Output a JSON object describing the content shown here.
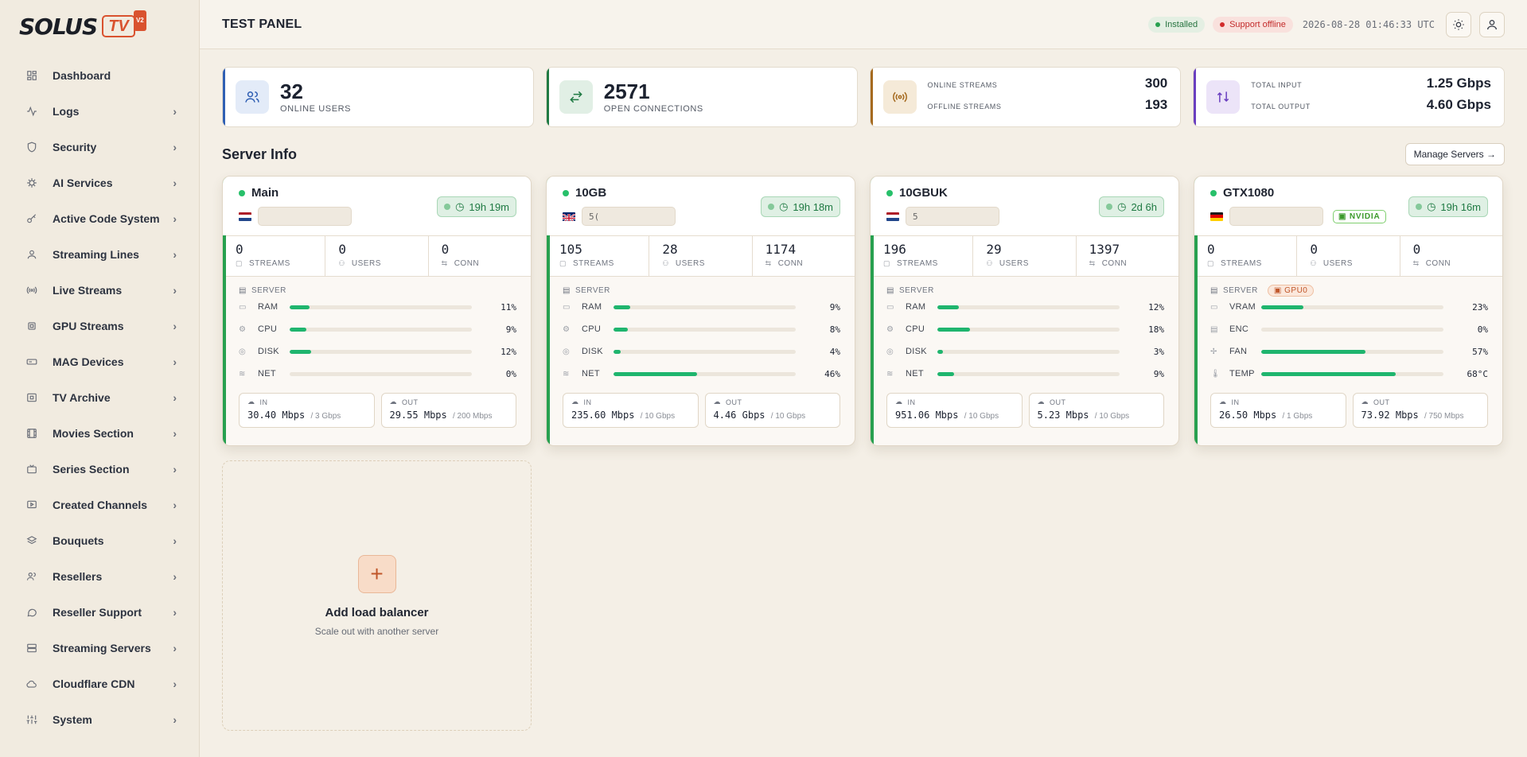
{
  "logo": {
    "word": "SOLUS",
    "tv": "TV",
    "badge": "V2"
  },
  "sidebar": {
    "items": [
      {
        "label": "Dashboard",
        "icon": "grid-icon",
        "chevron": false
      },
      {
        "label": "Logs",
        "icon": "activity-icon",
        "chevron": true
      },
      {
        "label": "Security",
        "icon": "shield-icon",
        "chevron": true
      },
      {
        "label": "AI Services",
        "icon": "cpu-icon",
        "chevron": true
      },
      {
        "label": "Active Code System",
        "icon": "key-icon",
        "chevron": true
      },
      {
        "label": "Streaming Lines",
        "icon": "user-icon",
        "chevron": true
      },
      {
        "label": "Live Streams",
        "icon": "broadcast-icon",
        "chevron": true
      },
      {
        "label": "GPU Streams",
        "icon": "chip-icon",
        "chevron": true
      },
      {
        "label": "MAG Devices",
        "icon": "device-icon",
        "chevron": true
      },
      {
        "label": "TV Archive",
        "icon": "archive-icon",
        "chevron": true
      },
      {
        "label": "Movies Section",
        "icon": "film-icon",
        "chevron": true
      },
      {
        "label": "Series Section",
        "icon": "tv-icon",
        "chevron": true
      },
      {
        "label": "Created Channels",
        "icon": "play-icon",
        "chevron": true
      },
      {
        "label": "Bouquets",
        "icon": "layers-icon",
        "chevron": true
      },
      {
        "label": "Resellers",
        "icon": "users-icon",
        "chevron": true
      },
      {
        "label": "Reseller Support",
        "icon": "chat-icon",
        "chevron": true
      },
      {
        "label": "Streaming Servers",
        "icon": "server-icon",
        "chevron": true
      },
      {
        "label": "Cloudflare CDN",
        "icon": "cloud-icon",
        "chevron": true
      },
      {
        "label": "System",
        "icon": "sliders-icon",
        "chevron": true
      }
    ]
  },
  "header": {
    "title": "TEST PANEL",
    "installed": "Installed",
    "support": "Support offline",
    "clock": "2026-08-28 01:46:33 UTC"
  },
  "stats": {
    "users": {
      "value": "32",
      "label": "ONLINE USERS"
    },
    "connections": {
      "value": "2571",
      "label": "OPEN CONNECTIONS"
    },
    "streams": {
      "online_label": "ONLINE STREAMS",
      "online_value": "300",
      "offline_label": "OFFLINE STREAMS",
      "offline_value": "193"
    },
    "traffic": {
      "input_label": "TOTAL INPUT",
      "input_value": "1.25 Gbps",
      "output_label": "TOTAL OUTPUT",
      "output_value": "4.60 Gbps"
    }
  },
  "section": {
    "title": "Server Info",
    "manage_label": "Manage Servers →"
  },
  "servers": [
    {
      "name": "Main",
      "flag": "nl",
      "ip": "",
      "uptime": "19h 19m",
      "gpu": false,
      "metrics": [
        {
          "v": "0",
          "l": "STREAMS"
        },
        {
          "v": "0",
          "l": "USERS"
        },
        {
          "v": "0",
          "l": "CONN"
        }
      ],
      "section_label": "SERVER",
      "bars": [
        {
          "label": "RAM",
          "value": "11%",
          "pct": 11
        },
        {
          "label": "CPU",
          "value": "9%",
          "pct": 9
        },
        {
          "label": "DISK",
          "value": "12%",
          "pct": 12
        },
        {
          "label": "NET",
          "value": "0%",
          "pct": 0
        }
      ],
      "in": {
        "label": "IN",
        "value": "30.40 Mbps",
        "cap": "/ 3 Gbps"
      },
      "out": {
        "label": "OUT",
        "value": "29.55 Mbps",
        "cap": "/ 200 Mbps"
      }
    },
    {
      "name": "10GB",
      "flag": "uk",
      "ip": "5(",
      "uptime": "19h 18m",
      "gpu": false,
      "metrics": [
        {
          "v": "105",
          "l": "STREAMS"
        },
        {
          "v": "28",
          "l": "USERS"
        },
        {
          "v": "1174",
          "l": "CONN"
        }
      ],
      "section_label": "SERVER",
      "bars": [
        {
          "label": "RAM",
          "value": "9%",
          "pct": 9
        },
        {
          "label": "CPU",
          "value": "8%",
          "pct": 8
        },
        {
          "label": "DISK",
          "value": "4%",
          "pct": 4
        },
        {
          "label": "NET",
          "value": "46%",
          "pct": 46
        }
      ],
      "in": {
        "label": "IN",
        "value": "235.60 Mbps",
        "cap": "/ 10 Gbps"
      },
      "out": {
        "label": "OUT",
        "value": "4.46 Gbps",
        "cap": "/ 10 Gbps"
      }
    },
    {
      "name": "10GBUK",
      "flag": "nl",
      "ip": "5",
      "uptime": "2d 6h",
      "gpu": false,
      "metrics": [
        {
          "v": "196",
          "l": "STREAMS"
        },
        {
          "v": "29",
          "l": "USERS"
        },
        {
          "v": "1397",
          "l": "CONN"
        }
      ],
      "section_label": "SERVER",
      "bars": [
        {
          "label": "RAM",
          "value": "12%",
          "pct": 12
        },
        {
          "label": "CPU",
          "value": "18%",
          "pct": 18
        },
        {
          "label": "DISK",
          "value": "3%",
          "pct": 3
        },
        {
          "label": "NET",
          "value": "9%",
          "pct": 9
        }
      ],
      "in": {
        "label": "IN",
        "value": "951.06 Mbps",
        "cap": "/ 10 Gbps"
      },
      "out": {
        "label": "OUT",
        "value": "5.23 Mbps",
        "cap": "/ 10 Gbps"
      }
    },
    {
      "name": "GTX1080",
      "flag": "de",
      "ip": "",
      "uptime": "19h 16m",
      "gpu": true,
      "gpu_badge": "NVIDIA",
      "gpu_tag": "GPU0",
      "metrics": [
        {
          "v": "0",
          "l": "STREAMS"
        },
        {
          "v": "0",
          "l": "USERS"
        },
        {
          "v": "0",
          "l": "CONN"
        }
      ],
      "section_label": "SERVER",
      "bars": [
        {
          "label": "VRAM",
          "value": "23%",
          "pct": 23
        },
        {
          "label": "ENC",
          "value": "0%",
          "pct": 0
        },
        {
          "label": "FAN",
          "value": "57%",
          "pct": 57
        },
        {
          "label": "TEMP",
          "value": "68°C",
          "pct": 74
        }
      ],
      "in": {
        "label": "IN",
        "value": "26.50 Mbps",
        "cap": "/ 1 Gbps"
      },
      "out": {
        "label": "OUT",
        "value": "73.92 Mbps",
        "cap": "/ 750 Mbps"
      }
    }
  ],
  "add_card": {
    "title": "Add load balancer",
    "subtitle": "Scale out with another server",
    "plus": "+"
  },
  "colors": {
    "accent": "#d9522f",
    "ok": "#27a04f",
    "bar": "#1fb56e"
  }
}
